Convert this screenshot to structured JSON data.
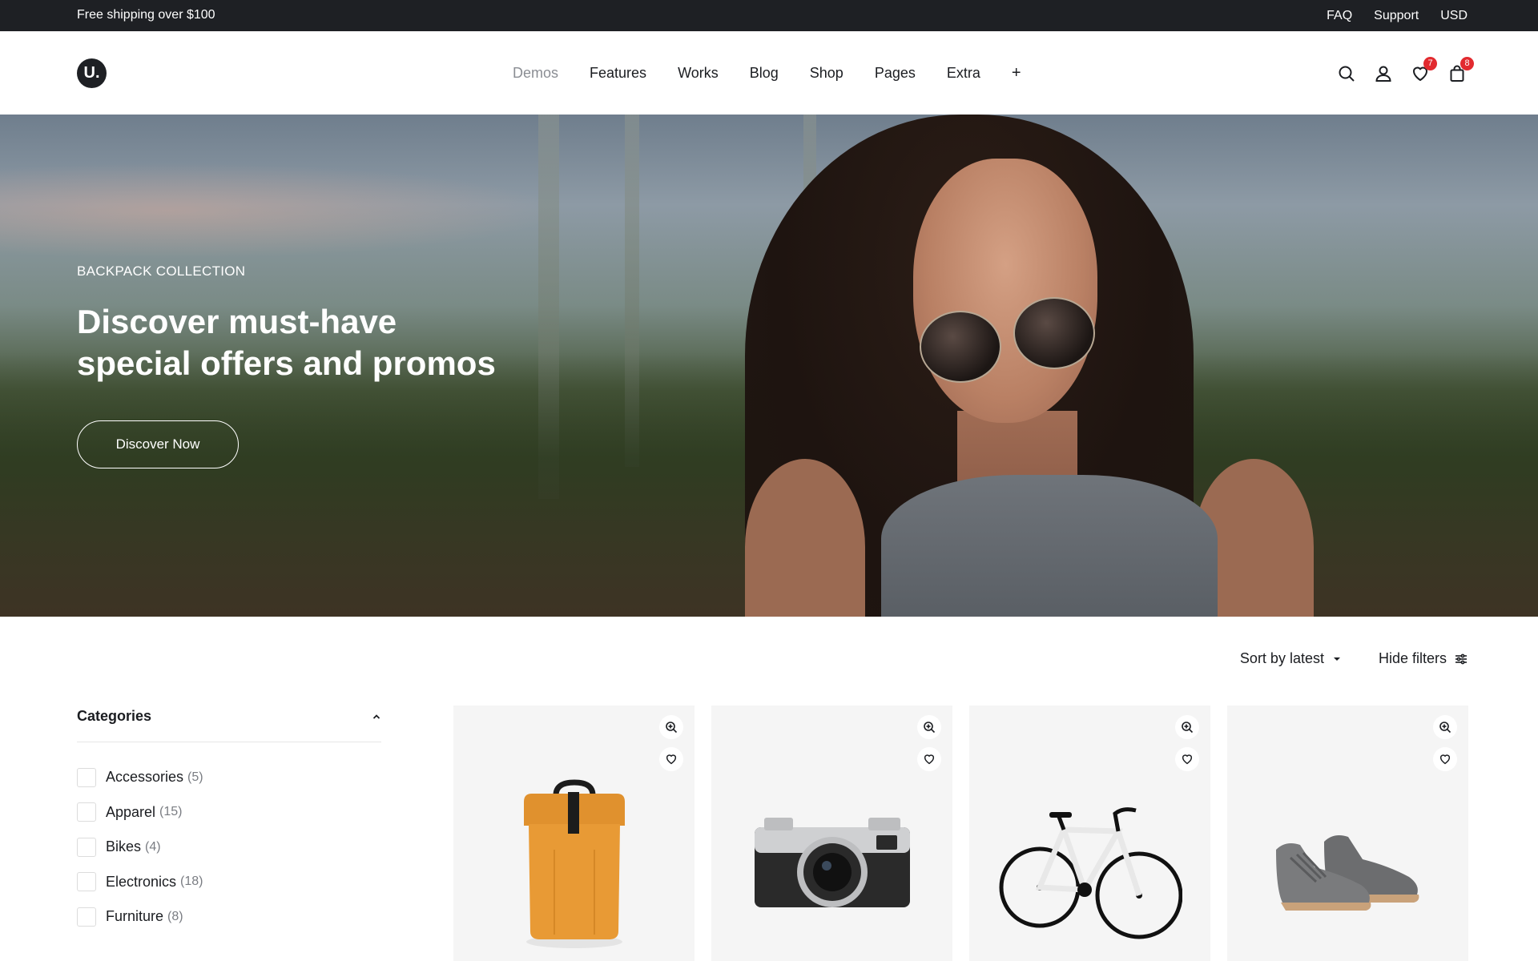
{
  "topbar": {
    "promo": "Free shipping over $100",
    "links": [
      "FAQ",
      "Support",
      "USD"
    ]
  },
  "header": {
    "logo": "U.",
    "nav": [
      "Demos",
      "Features",
      "Works",
      "Blog",
      "Shop",
      "Pages",
      "Extra",
      "+"
    ],
    "active_nav": "Demos",
    "wishlist_count": "7",
    "cart_count": "8"
  },
  "hero": {
    "eyebrow": "BACKPACK COLLECTION",
    "headline_line1": "Discover must-have",
    "headline_line2": "special offers and promos",
    "cta": "Discover Now"
  },
  "toolbar": {
    "sort": "Sort by latest",
    "filters": "Hide filters"
  },
  "sidebar": {
    "title": "Categories",
    "categories": [
      {
        "name": "Accessories",
        "count": "(5)"
      },
      {
        "name": "Apparel",
        "count": "(15)"
      },
      {
        "name": "Bikes",
        "count": "(4)"
      },
      {
        "name": "Electronics",
        "count": "(18)"
      },
      {
        "name": "Furniture",
        "count": "(8)"
      }
    ]
  },
  "products": [
    {
      "icon": "backpack-icon"
    },
    {
      "icon": "camera-icon"
    },
    {
      "icon": "bicycle-icon"
    },
    {
      "icon": "sneakers-icon"
    }
  ],
  "colors": {
    "topbar_bg": "#1e2024",
    "badge": "#e22a2f",
    "card_bg": "#f5f5f5"
  }
}
